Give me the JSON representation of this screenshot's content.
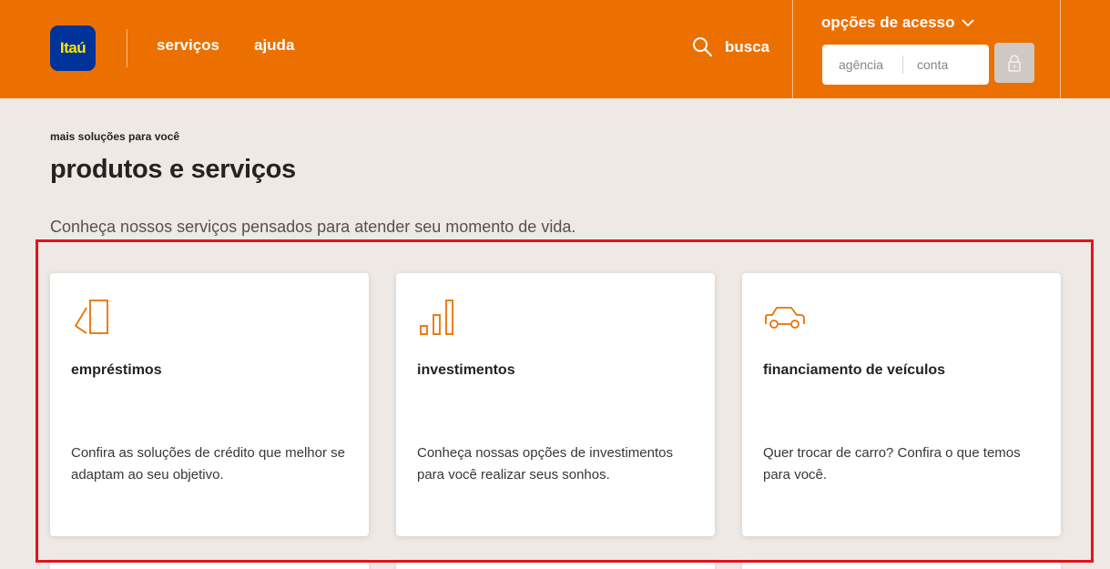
{
  "header": {
    "logo_text": "Itaú",
    "nav": [
      {
        "label": "serviços"
      },
      {
        "label": "ajuda"
      }
    ],
    "search_label": "busca",
    "access_title": "opções de acesso",
    "agencia_placeholder": "agência",
    "conta_placeholder": "conta"
  },
  "section": {
    "eyebrow": "mais soluções para você",
    "title": "produtos e serviços",
    "intro": "Conheça nossos serviços pensados para atender seu momento de vida."
  },
  "cards": [
    {
      "icon": "loan-icon",
      "title": "empréstimos",
      "description": "Confira as soluções de crédito que melhor se adaptam ao seu objetivo."
    },
    {
      "icon": "investment-bars-icon",
      "title": "investimentos",
      "description": "Conheça nossas opções de investimentos para você realizar seus sonhos."
    },
    {
      "icon": "car-icon",
      "title": "financiamento de veículos",
      "description": "Quer trocar de carro? Confira o que temos para você."
    }
  ],
  "colors": {
    "brand_orange": "#ec7000",
    "logo_blue": "#003399",
    "logo_yellow": "#ffe600",
    "background": "#efe9e5",
    "highlight_red": "#e0141e"
  }
}
